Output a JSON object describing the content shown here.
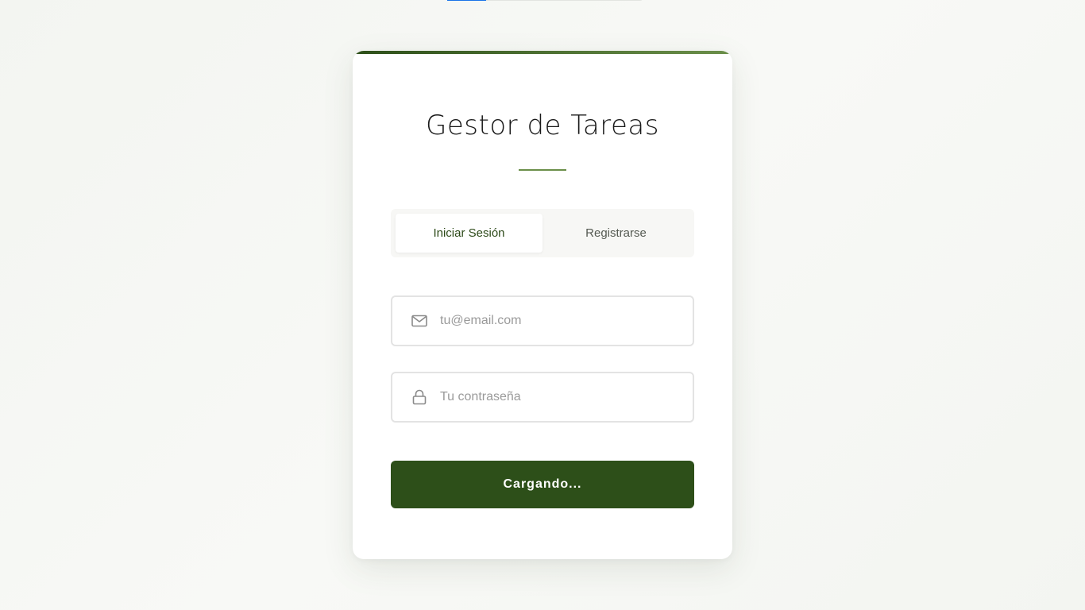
{
  "app": {
    "title": "Gestor de Tareas"
  },
  "progress": {
    "value": 0.2
  },
  "tabs": [
    {
      "label": "Iniciar Sesión",
      "active": true
    },
    {
      "label": "Registrarse",
      "active": false
    }
  ],
  "form": {
    "email": {
      "placeholder": "tu@email.com",
      "value": "",
      "icon": "mail-icon"
    },
    "password": {
      "placeholder": "Tu contraseña",
      "value": "",
      "icon": "lock-icon"
    },
    "submit_label": "Cargando..."
  },
  "colors": {
    "brand": "#2d4f19",
    "accent_gradient_start": "#2d4f19",
    "accent_gradient_end": "#6b8f4a",
    "progress": "#1a73e8"
  }
}
